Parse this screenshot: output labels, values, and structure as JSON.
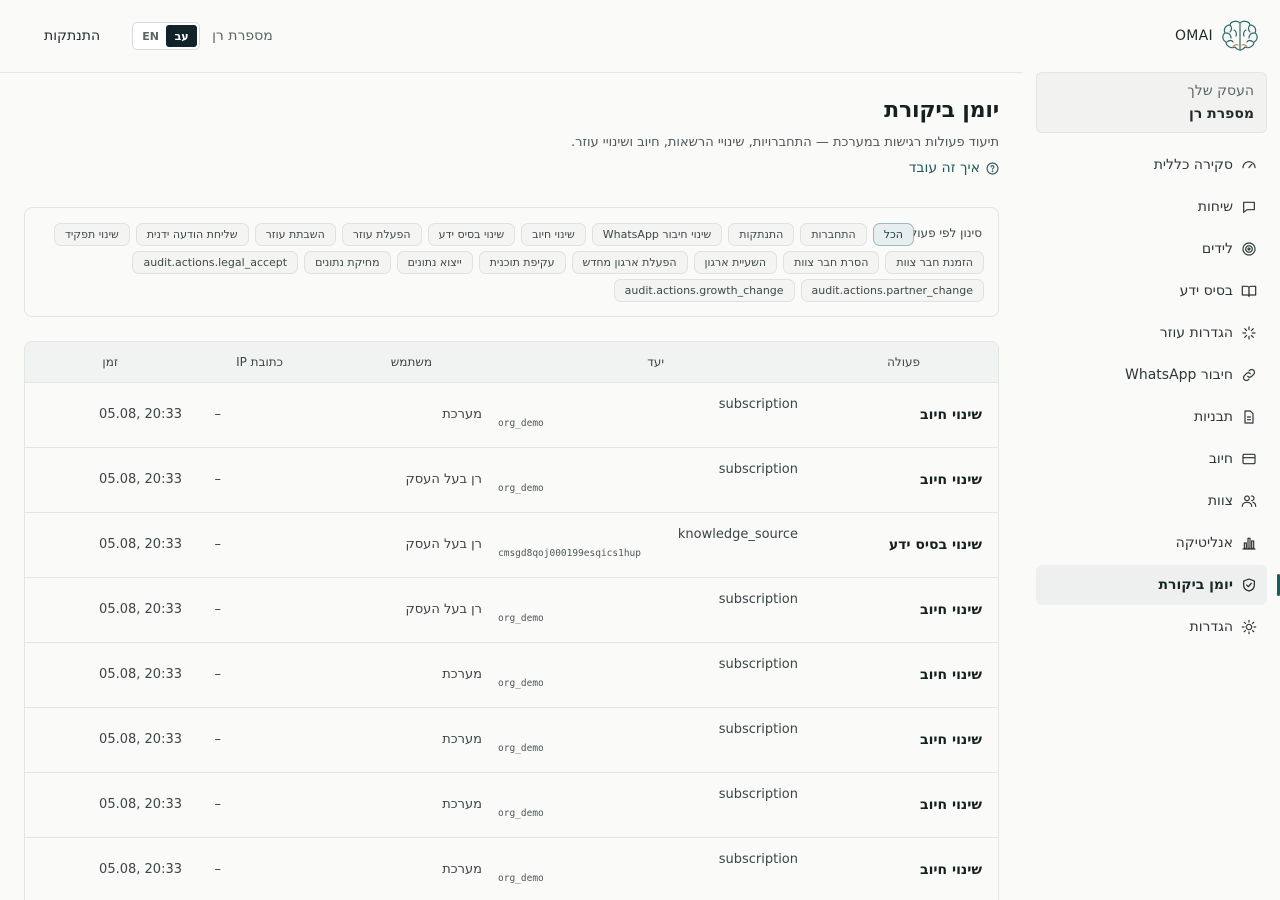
{
  "brand": {
    "name": "OMAI",
    "logo_icon": "brain-icon"
  },
  "business": {
    "label": "העסק שלך",
    "name": "מספרת רן"
  },
  "nav": [
    {
      "label": "סקירה כללית",
      "icon": "gauge-icon"
    },
    {
      "label": "שיחות",
      "icon": "chat-icon"
    },
    {
      "label": "לידים",
      "icon": "target-icon"
    },
    {
      "label": "בסיס ידע",
      "icon": "book-icon"
    },
    {
      "label": "הגדרות עוזר",
      "icon": "sparkle-icon"
    },
    {
      "label": "חיבור WhatsApp",
      "icon": "link-icon"
    },
    {
      "label": "תבניות",
      "icon": "document-icon"
    },
    {
      "label": "חיוב",
      "icon": "credit-card-icon"
    },
    {
      "label": "צוות",
      "icon": "users-icon"
    },
    {
      "label": "אנליטיקה",
      "icon": "bar-chart-icon"
    },
    {
      "label": "יומן ביקורת",
      "icon": "shield-check-icon",
      "active": true
    },
    {
      "label": "הגדרות",
      "icon": "sun-gear-icon"
    }
  ],
  "topbar": {
    "logout_label": "התנתקות",
    "languages": [
      "EN",
      "עב"
    ],
    "active_language": "עב",
    "tenant_name": "מספרת רן"
  },
  "page": {
    "title": "יומן ביקורת",
    "subtitle": "תיעוד פעולות רגישות במערכת — התחברויות, שינויי הרשאות, חיוב ושינויי עוזר.",
    "how_link": "איך זה עובד"
  },
  "filters": {
    "label": "סינון לפי פעולה:",
    "chips": [
      "הכל",
      "התחברות",
      "התנתקות",
      "שינוי חיבור WhatsApp",
      "שינוי חיוב",
      "שינוי בסיס ידע",
      "הפעלת עוזר",
      "השבתת עוזר",
      "שליחת הודעה ידנית",
      "שינוי תפקיד",
      "הזמנת חבר צוות",
      "הסרת חבר צוות",
      "השעיית ארגון",
      "הפעלת ארגון מחדש",
      "עקיפת תוכנית",
      "ייצוא נתונים",
      "מחיקת נתונים",
      "audit.actions.legal_accept",
      "audit.actions.partner_change",
      "audit.actions.growth_change"
    ],
    "active": "הכל"
  },
  "table": {
    "columns": {
      "action": "פעולה",
      "target": "יעד",
      "user": "משתמש",
      "ip": "כתובת IP",
      "time": "זמן"
    },
    "rows": [
      {
        "action": "שינוי חיוב",
        "target_type": "subscription",
        "target_id": "org_demo",
        "user": "מערכת",
        "ip": "–",
        "time": "05.08, 20:33"
      },
      {
        "action": "שינוי חיוב",
        "target_type": "subscription",
        "target_id": "org_demo",
        "user": "רן בעל העסק",
        "ip": "–",
        "time": "05.08, 20:33"
      },
      {
        "action": "שינוי בסיס ידע",
        "target_type": "knowledge_source",
        "target_id": "cmsgd8qoj000199esqics1hup",
        "user": "רן בעל העסק",
        "ip": "–",
        "time": "05.08, 20:33"
      },
      {
        "action": "שינוי חיוב",
        "target_type": "subscription",
        "target_id": "org_demo",
        "user": "רן בעל העסק",
        "ip": "–",
        "time": "05.08, 20:33"
      },
      {
        "action": "שינוי חיוב",
        "target_type": "subscription",
        "target_id": "org_demo",
        "user": "מערכת",
        "ip": "–",
        "time": "05.08, 20:33"
      },
      {
        "action": "שינוי חיוב",
        "target_type": "subscription",
        "target_id": "org_demo",
        "user": "מערכת",
        "ip": "–",
        "time": "05.08, 20:33"
      },
      {
        "action": "שינוי חיוב",
        "target_type": "subscription",
        "target_id": "org_demo",
        "user": "מערכת",
        "ip": "–",
        "time": "05.08, 20:33"
      },
      {
        "action": "שינוי חיוב",
        "target_type": "subscription",
        "target_id": "org_demo",
        "user": "מערכת",
        "ip": "–",
        "time": "05.08, 20:33"
      }
    ]
  },
  "colors": {
    "accent": "#1f5a5a",
    "active_lang_bg": "#13232a",
    "chip_active_bg": "#e6eef0"
  }
}
